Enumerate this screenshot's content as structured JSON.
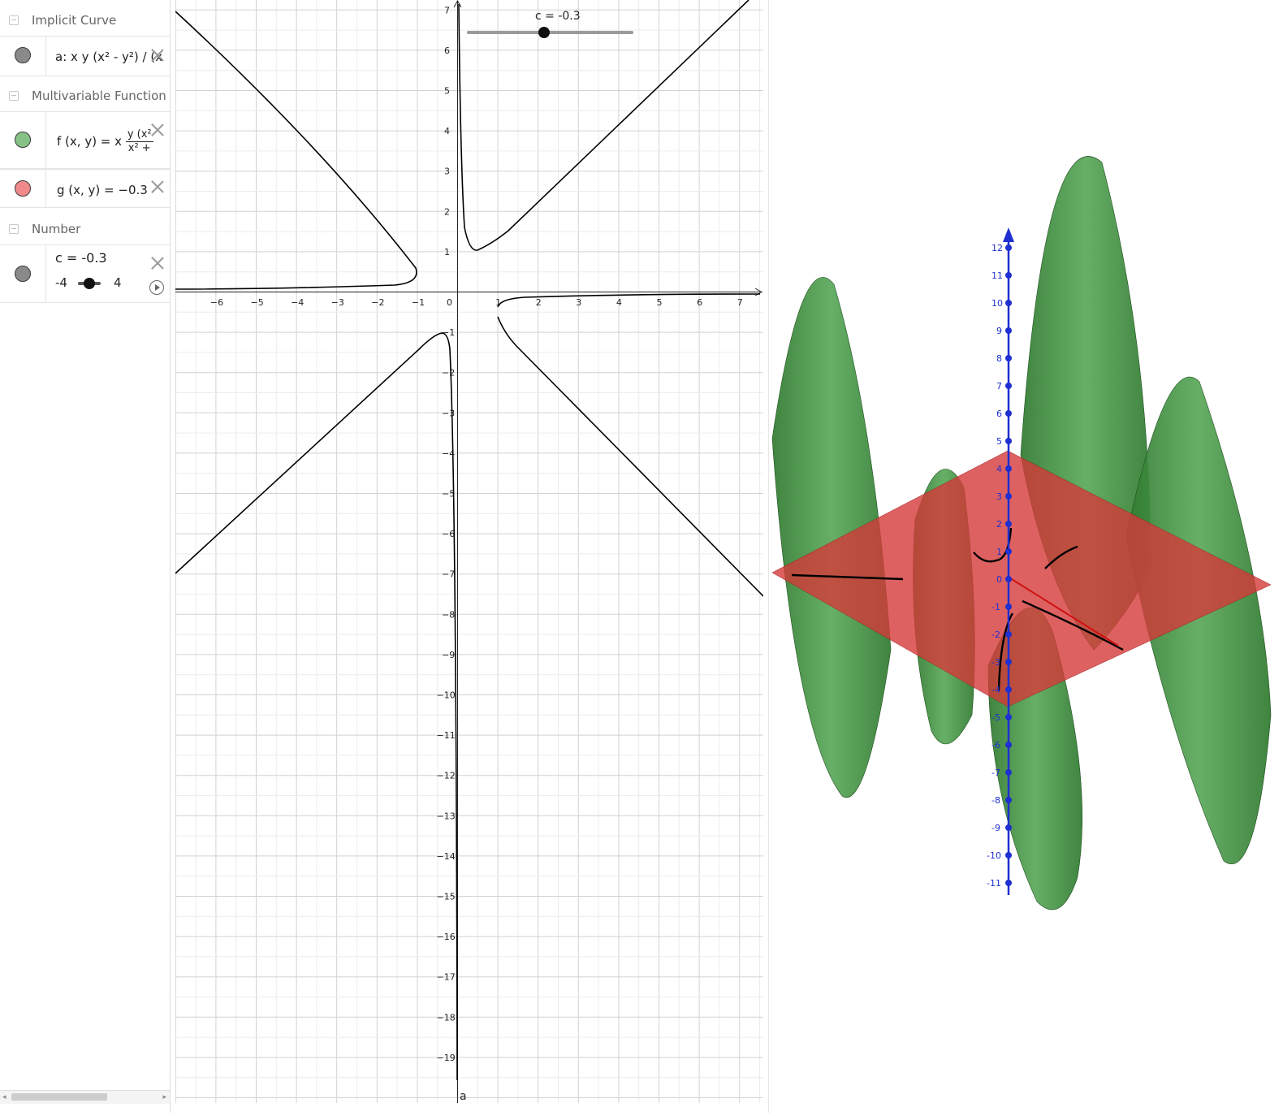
{
  "algebra": {
    "categories": {
      "implicit": "Implicit Curve",
      "multivariable": "Multivariable Function",
      "number": "Number"
    },
    "items": {
      "a": {
        "text": "a: x y (x² - y²) / (x",
        "marble_color": "#8a8a8a"
      },
      "f": {
        "lhs": "f (x, y)  =  x",
        "num": "y  (x²",
        "den": "x² +",
        "marble_color": "#86c186"
      },
      "g": {
        "text": "g (x, y)  =  −0.3",
        "marble_color": "#f08a8a"
      },
      "c": {
        "text": "c = -0.3",
        "min": "-4",
        "max": "4",
        "marble_color": "#8a8a8a"
      }
    }
  },
  "graphics2d": {
    "slider_label": "c = -0.3",
    "slider_value": -0.3,
    "slider_min": -4,
    "slider_max": 4,
    "curve_label": "a",
    "x_ticks": [
      "−6",
      "−5",
      "−4",
      "−3",
      "−2",
      "−1",
      "1",
      "2",
      "3",
      "4",
      "5",
      "6",
      "7"
    ],
    "y_ticks_pos": [
      "1",
      "2",
      "3",
      "4",
      "5",
      "6",
      "7"
    ],
    "y_ticks_neg": [
      "−1",
      "−2",
      "−3",
      "−4",
      "−5",
      "−6",
      "−7",
      "−8",
      "−9",
      "−10",
      "−11",
      "−12",
      "−13",
      "−14",
      "−15",
      "−16",
      "−17",
      "−18",
      "−19"
    ],
    "origin": "0",
    "colors": {
      "curve": "#000000",
      "grid": "#d6d6d6",
      "axis": "#222222"
    }
  },
  "view3d": {
    "z_ticks": [
      "12",
      "11",
      "10",
      "9",
      "8",
      "7",
      "6",
      "5",
      "4",
      "3",
      "2",
      "1",
      "0",
      "-1",
      "-2",
      "-3",
      "-4",
      "-5",
      "-6",
      "-7",
      "-8",
      "-9",
      "-10",
      "-11"
    ],
    "colors": {
      "surface": "#3f8f3f",
      "plane": "#d43a3a",
      "z_axis": "#1f2fd0",
      "x_axis": "#d01010"
    }
  }
}
